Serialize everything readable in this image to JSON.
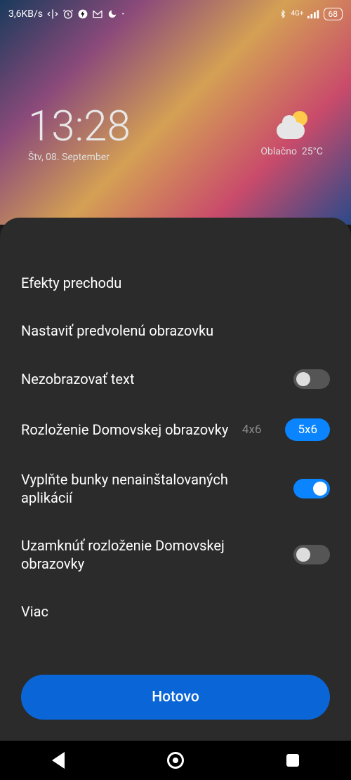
{
  "status": {
    "data_rate": "3,6KB/s",
    "signal_label": "4G+",
    "battery": "68"
  },
  "home": {
    "time": "13:28",
    "date": "Štv, 08. September",
    "weather_desc": "Oblačno",
    "weather_temp": "25°C"
  },
  "settings": {
    "transition_effects": "Efekty prechodu",
    "set_default_screen": "Nastaviť predvolenú obrazovku",
    "hide_text": {
      "label": "Nezobrazovať text",
      "on": false
    },
    "home_layout": {
      "label": "Rozloženie Domovskej obrazovky",
      "options": [
        "4x6",
        "5x6"
      ],
      "selected": "5x6"
    },
    "fill_cells": {
      "label": "Vyplňte bunky nenainštalovaných aplikácií",
      "on": true
    },
    "lock_layout": {
      "label": "Uzamknúť rozloženie Domovskej obrazovky",
      "on": false
    },
    "more": "Viac",
    "done": "Hotovo"
  }
}
